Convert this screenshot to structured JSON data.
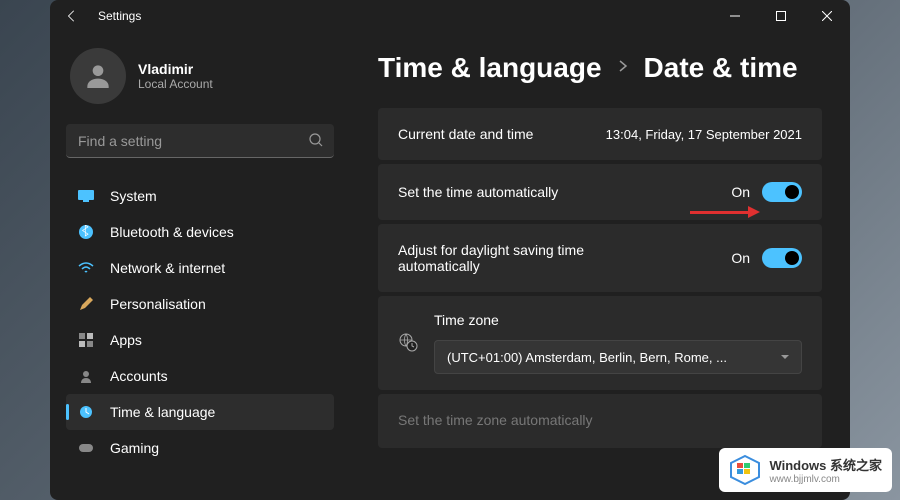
{
  "window": {
    "title": "Settings"
  },
  "profile": {
    "name": "Vladimir",
    "sub": "Local Account"
  },
  "search": {
    "placeholder": "Find a setting"
  },
  "nav": [
    {
      "label": "System",
      "icon": "system",
      "color": "#4cc2ff"
    },
    {
      "label": "Bluetooth & devices",
      "icon": "bluetooth",
      "color": "#4cc2ff"
    },
    {
      "label": "Network & internet",
      "icon": "wifi",
      "color": "#4cc2ff"
    },
    {
      "label": "Personalisation",
      "icon": "brush",
      "color": "#d9a85c"
    },
    {
      "label": "Apps",
      "icon": "apps",
      "color": "#888"
    },
    {
      "label": "Accounts",
      "icon": "accounts",
      "color": "#888"
    },
    {
      "label": "Time & language",
      "icon": "time",
      "color": "#4cc2ff",
      "active": true
    },
    {
      "label": "Gaming",
      "icon": "gaming",
      "color": "#888"
    }
  ],
  "breadcrumb": {
    "parent": "Time & language",
    "current": "Date & time"
  },
  "cards": {
    "current": {
      "label": "Current date and time",
      "value": "13:04, Friday, 17 September 2021"
    },
    "autoTime": {
      "label": "Set the time automatically",
      "state": "On"
    },
    "dst": {
      "label": "Adjust for daylight saving time automatically",
      "state": "On"
    },
    "timezone": {
      "label": "Time zone",
      "value": "(UTC+01:00) Amsterdam, Berlin, Bern, Rome, ..."
    },
    "autoTz": {
      "label": "Set the time zone automatically"
    }
  },
  "watermark": {
    "title": "Windows 系统之家",
    "url": "www.bjjmlv.com"
  }
}
